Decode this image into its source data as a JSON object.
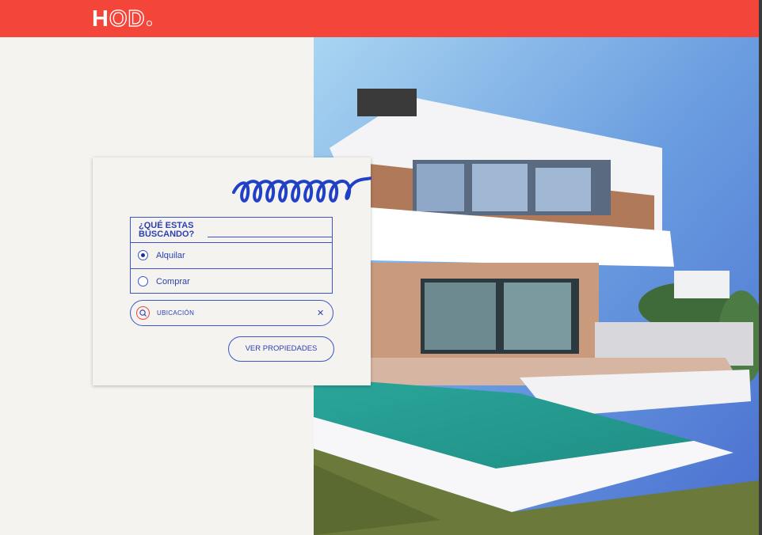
{
  "brand": {
    "logo_solid": "H",
    "logo_outline": "OD",
    "accent": "#f4453b",
    "primary": "#2c40b0"
  },
  "search_card": {
    "question": "¿QUÉ ESTAS BUSCANDO?",
    "options": [
      {
        "label": "Alquilar",
        "selected": true
      },
      {
        "label": "Comprar",
        "selected": false
      }
    ],
    "location_placeholder": "UBICACIÓN",
    "submit_label": "VER PROPIEDADES"
  },
  "icons": {
    "search": "search-icon",
    "clear": "close-icon",
    "decoration": "squiggle-icon"
  }
}
